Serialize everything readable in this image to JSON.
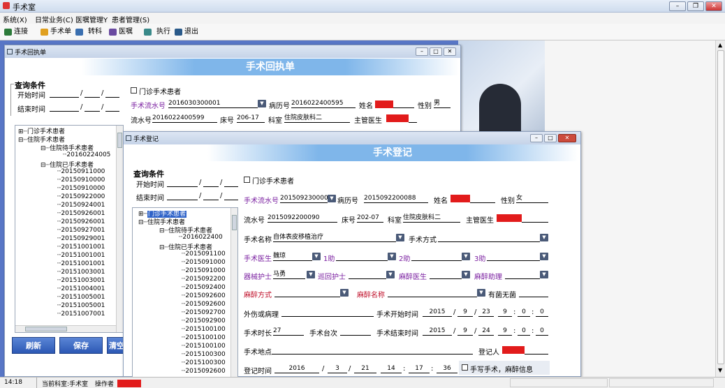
{
  "app": {
    "title": "手术室"
  },
  "menu": [
    "系统(X)",
    "日常业务(C)",
    "医嘱管理Y",
    "患者管理(S)"
  ],
  "toolbar": [
    "连接",
    "手术单",
    "转科",
    "医嘱",
    "执行",
    "退出"
  ],
  "colors": {
    "banner": "#7fb6ea",
    "purple_label": "#7a1fa0",
    "red_label": "#c0102a",
    "redacted": "#e21b1b",
    "mdi_blue": "#5876c6"
  },
  "w1": {
    "title": "手术回执单",
    "banner": "手术回执单",
    "query": "查询条件",
    "start": "开始时间",
    "end": "结束时间",
    "slash": "/",
    "outpatient_check": "门诊手术患者",
    "op_no_label": "手术流水号",
    "op_no": "2016030300001",
    "record_label": "病历号",
    "record": "2016022400595",
    "name_label": "姓名",
    "gender_label": "性别",
    "gender": "男",
    "flow_label": "流水号",
    "flow": "2016022400599",
    "bed_label": "床号",
    "bed": "206-17",
    "dept_label": "科室",
    "dept": "住院皮肤科二",
    "doctor_label": "主管医生",
    "tree": [
      "门诊手术患者",
      "住院手术患者",
      "住院待手术患者",
      "20160224005",
      "住院已手术患者",
      "20150911000",
      "20150910000",
      "20150910000",
      "20150922000",
      "20150924001",
      "20150926001",
      "20150926001",
      "20150927001",
      "20150929001",
      "20151001001",
      "20151001001",
      "20151001001",
      "20151003001",
      "20151003001",
      "20151004001",
      "20151005001",
      "20151005001",
      "20151007001"
    ],
    "btn_refresh": "刷新",
    "btn_save": "保存",
    "btn_clear": "清空"
  },
  "w2": {
    "title": "手术登记",
    "banner": "手术登记",
    "query": "查询条件",
    "start": "开始时间",
    "end": "结束时间",
    "slash": "/",
    "outpatient_check": "门诊手术患者",
    "op_no_label": "手术流水号",
    "op_no": "2015092300001",
    "record_label": "病历号",
    "record": "2015092200088",
    "name_label": "姓名",
    "gender_label": "性别",
    "gender": "女",
    "flow_label": "流水号",
    "flow": "2015092200090",
    "bed_label": "床号",
    "bed": "202-07",
    "dept_label": "科室",
    "dept": "住院皮肤科二",
    "doctor_label": "主管医生",
    "surgery_name_label": "手术名称",
    "surgery_name": "自体表皮移植治疗",
    "method_label": "手术方式",
    "surgeon_label": "手术医生",
    "surgeon": "魏琼",
    "a1": "1助",
    "a2": "2助",
    "a3": "3助",
    "inst_nurse_label": "器械护士",
    "inst_nurse": "马勇",
    "circ_nurse": "巡回护士",
    "anes_doctor": "麻醉医生",
    "anes_assist": "麻醉助理",
    "anes_method": "麻醉方式",
    "anes_name": "麻醉名称",
    "sterile": "有菌无菌",
    "pathology": "外伤或病理",
    "start_time_label": "手术开始时间",
    "start_time": [
      "2015",
      "9",
      "23",
      "9",
      "0",
      "0"
    ],
    "duration_label": "手术时长",
    "duration": "27",
    "count_label": "手术台次",
    "end_time_label": "手术结束时间",
    "end_time": [
      "2015",
      "9",
      "24",
      "9",
      "0",
      "0"
    ],
    "location_label": "手术地点",
    "registrar_label": "登记人",
    "reg_time_label": "登记时间",
    "reg_time": [
      "2016",
      "3",
      "21",
      "14",
      "17",
      "36"
    ],
    "manual_check": "手写手术，麻醉信息",
    "tree": [
      "门诊手术患者",
      "住院手术患者",
      "住院待手术患者",
      "2016022400",
      "住院已手术患者",
      "2015091100",
      "2015091000",
      "2015091000",
      "2015092200",
      "2015092400",
      "2015092600",
      "2015092600",
      "2015092700",
      "2015092900",
      "2015100100",
      "2015100100",
      "2015100100",
      "2015100300",
      "2015100300",
      "2015092600"
    ]
  },
  "status": {
    "time": "14:18",
    "dept": "当前科室:手术室",
    "operator": "操作者"
  }
}
